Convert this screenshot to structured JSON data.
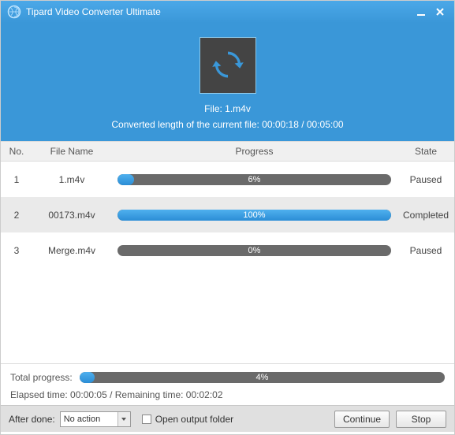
{
  "titlebar": {
    "title": "Tipard Video Converter Ultimate"
  },
  "header": {
    "file_label": "File: 1.m4v",
    "conv_label": "Converted length of the current file: 00:00:18 / 00:05:00"
  },
  "columns": {
    "no": "No.",
    "name": "File Name",
    "progress": "Progress",
    "state": "State"
  },
  "rows": [
    {
      "no": "1",
      "name": "1.m4v",
      "pct": 6,
      "pct_label": "6%",
      "state": "Paused"
    },
    {
      "no": "2",
      "name": "00173.m4v",
      "pct": 100,
      "pct_label": "100%",
      "state": "Completed"
    },
    {
      "no": "3",
      "name": "Merge.m4v",
      "pct": 0,
      "pct_label": "0%",
      "state": "Paused"
    }
  ],
  "total": {
    "label": "Total progress:",
    "pct": 4,
    "pct_label": "4%",
    "elapsed": "Elapsed time: 00:00:05 / Remaining time: 00:02:02"
  },
  "footer": {
    "after_done_label": "After done:",
    "after_done_value": "No action",
    "open_output_label": "Open output folder",
    "continue_btn": "Continue",
    "stop_btn": "Stop"
  }
}
